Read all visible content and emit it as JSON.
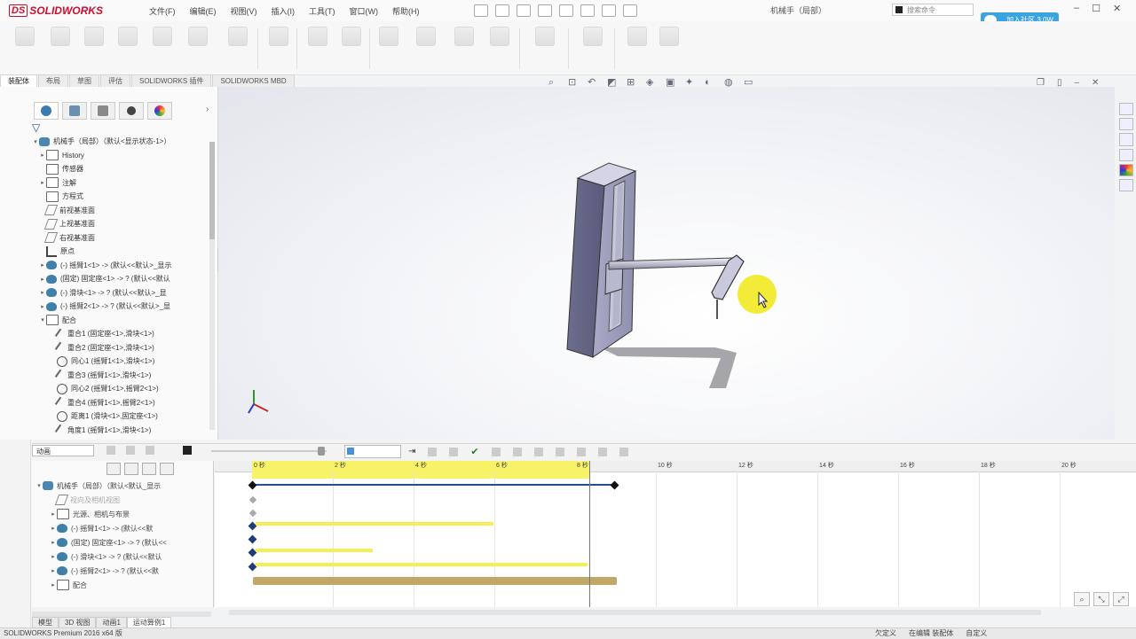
{
  "app": {
    "logo": "SOLIDWORKS",
    "menus": [
      "文件(F)",
      "编辑(E)",
      "视图(V)",
      "插入(I)",
      "工具(T)",
      "窗口(W)",
      "帮助(H)"
    ],
    "doc_title": "机械手（局部）",
    "search_placeholder": "搜索命令",
    "cloud_button": "加入社区 3.0W"
  },
  "command_tabs": [
    "装配体",
    "布局",
    "草图",
    "评估",
    "SOLIDWORKS 插件",
    "SOLIDWORKS MBD"
  ],
  "feature_tree": {
    "root": "机械手（局部）（默认<显示状态-1>）",
    "items": [
      {
        "label": "History",
        "icon": "history-folder-icon",
        "level": 1
      },
      {
        "label": "传感器",
        "icon": "sensor-icon",
        "level": 1
      },
      {
        "label": "注解",
        "icon": "annotation-icon",
        "level": 1
      },
      {
        "label": "方程式",
        "icon": "equation-icon",
        "level": 1
      },
      {
        "label": "前视基准面",
        "icon": "plane-icon",
        "level": 1
      },
      {
        "label": "上视基准面",
        "icon": "plane-icon",
        "level": 1
      },
      {
        "label": "右视基准面",
        "icon": "plane-icon",
        "level": 1
      },
      {
        "label": "原点",
        "icon": "origin-icon",
        "level": 1
      },
      {
        "label": "(-) 摇臂1<1> -> (默认<<默认>_显示",
        "icon": "part-icon",
        "level": 1
      },
      {
        "label": "(固定) 固定座<1> -> ? (默认<<默认",
        "icon": "part-icon",
        "level": 1
      },
      {
        "label": "(-) 滑块<1> -> ? (默认<<默认>_显",
        "icon": "part-icon",
        "level": 1
      },
      {
        "label": "(-) 摇臂2<1> -> ? (默认<<默认>_显",
        "icon": "part-icon",
        "level": 1
      },
      {
        "label": "配合",
        "icon": "mates-folder-icon",
        "level": 1
      },
      {
        "label": "重合1 (固定座<1>,滑块<1>)",
        "icon": "coincident-icon",
        "level": 2
      },
      {
        "label": "重合2 (固定座<1>,滑块<1>)",
        "icon": "coincident-icon",
        "level": 2
      },
      {
        "label": "同心1 (摇臂1<1>,滑块<1>)",
        "icon": "concentric-icon",
        "level": 2
      },
      {
        "label": "重合3 (摇臂1<1>,滑块<1>)",
        "icon": "coincident-icon",
        "level": 2
      },
      {
        "label": "同心2 (摇臂1<1>,摇臂2<1>)",
        "icon": "concentric-icon",
        "level": 2
      },
      {
        "label": "重合4 (摇臂1<1>,摇臂2<1>)",
        "icon": "coincident-icon",
        "level": 2
      },
      {
        "label": "距离1 (滑块<1>,固定座<1>)",
        "icon": "distance-icon",
        "level": 2
      },
      {
        "label": "角度1 (摇臂1<1>,滑块<1>)",
        "icon": "angle-icon",
        "level": 2
      }
    ]
  },
  "motion_manager": {
    "study_type": "动画",
    "time_ticks": [
      "0 秒",
      "2 秒",
      "4 秒",
      "6 秒",
      "8 秒",
      "10 秒",
      "12 秒",
      "14 秒",
      "16 秒",
      "18 秒",
      "20 秒"
    ],
    "rows": [
      {
        "label": "机械手（局部）（默认<默认_显示",
        "level": 0
      },
      {
        "label": "视向及相机视图",
        "level": 1
      },
      {
        "label": "光源、相机与布景",
        "level": 1
      },
      {
        "label": "(-) 摇臂1<1> -> (默认<<默",
        "level": 1
      },
      {
        "label": "(固定) 固定座<1> -> ? (默认<<",
        "level": 1
      },
      {
        "label": "(-) 滑块<1> -> ? (默认<<默认",
        "level": 1
      },
      {
        "label": "(-) 摇臂2<1> -> ? (默认<<默",
        "level": 1
      },
      {
        "label": "配合",
        "level": 1
      }
    ],
    "bottom_tabs": [
      "模型",
      "3D 视图",
      "动画1",
      "运动算例1"
    ]
  },
  "status": {
    "left": "SOLIDWORKS Premium 2016 x64 版",
    "right": [
      "欠定义",
      "在编辑 装配体",
      "自定义"
    ]
  }
}
